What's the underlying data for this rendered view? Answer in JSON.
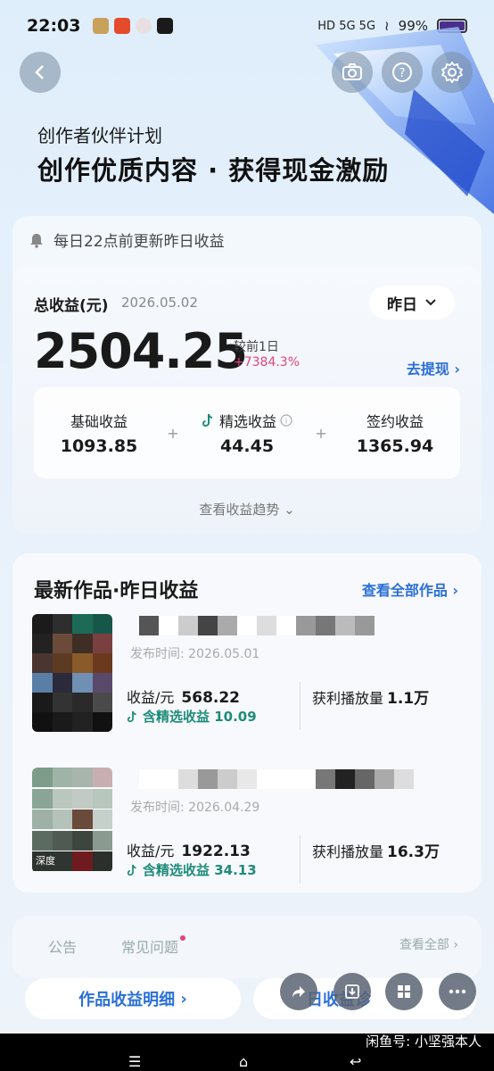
{
  "status_bar": {
    "time": "22:03",
    "battery": "99%",
    "battery_level": 0.99
  },
  "hero": {
    "subtitle": "创作者伙伴计划",
    "title": "创作优质内容 · 获得现金激励"
  },
  "earnings": {
    "notice": "每日22点前更新昨日收益",
    "total_label": "总收益(元)",
    "date": "2026.05.02",
    "period": "昨日",
    "total": "2504.25",
    "compare_label": "较前1日",
    "compare_value": "+7384.3%",
    "withdraw": "去提现",
    "breakdown": [
      {
        "label": "基础收益",
        "value": "1093.85"
      },
      {
        "label": "精选收益",
        "value": "44.45"
      },
      {
        "label": "签约收益",
        "value": "1365.94"
      }
    ],
    "trend": "查看收益趋势"
  },
  "works": {
    "title": "最新作品·昨日收益",
    "view_all": "查看全部作品",
    "items": [
      {
        "pub_date": "发布时间: 2026.05.01",
        "revenue_label": "收益/元",
        "revenue": "568.22",
        "selected": "含精选收益 10.09",
        "plays_label": "获利播放量",
        "plays": "1.1万"
      },
      {
        "pub_date": "发布时间: 2026.04.29",
        "revenue_label": "收益/元",
        "revenue": "1922.13",
        "selected": "含精选收益 34.13",
        "plays_label": "获利播放量",
        "plays": "16.3万",
        "thumb_text": "深度"
      }
    ]
  },
  "bottom": {
    "tab_notice": "公告",
    "tab_faq": "常见问题",
    "view_all": "查看全部",
    "btn_detail": "作品收益明细",
    "btn_right": "日收益诊"
  },
  "watermark": "闲鱼号: 小坚强本人",
  "colors": {
    "accent": "#2a6fd6",
    "increase": "#e0457b",
    "selected": "#1f8b7a"
  }
}
